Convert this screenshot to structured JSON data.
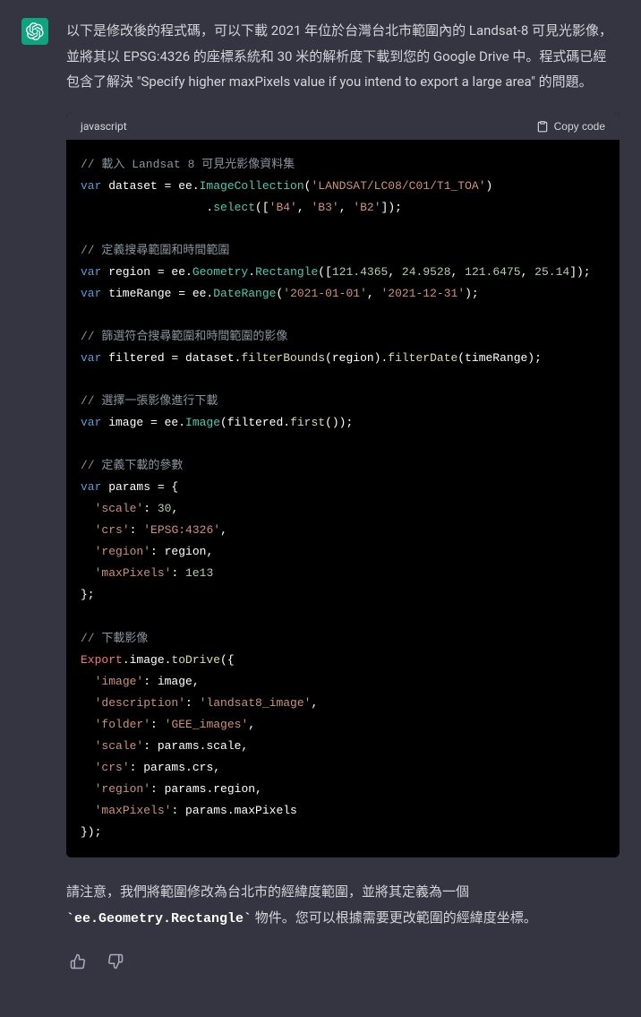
{
  "intro": "以下是修改後的程式碼，可以下載 2021 年位於台灣台北市範圍內的 Landsat-8 可見光影像，並將其以 EPSG:4326 的座標系統和 30 米的解析度下載到您的 Google Drive 中。程式碼已經包含了解決 \"Specify higher maxPixels value if you intend to export a large area\" 的問題。",
  "code_header": {
    "language": "javascript",
    "copy_label": "Copy code"
  },
  "code": {
    "c1": "// 載入 Landsat 8 可見光影像資料集",
    "kw_var": "var",
    "v_dataset": " dataset = ee.",
    "m_ic": "ImageCollection",
    "s_landsat": "'LANDSAT/LC08/C01/T1_TOA'",
    "pad_select": "                  .",
    "m_select": "select",
    "s_b4": "'B4'",
    "s_b3": "'B3'",
    "s_b2": "'B2'",
    "c2": "// 定義搜尋範圍和時間範圍",
    "v_region": " region = ee.",
    "m_geo": "Geometry",
    "m_rect": "Rectangle",
    "n1": "121.4365",
    "n2": "24.9528",
    "n3": "121.6475",
    "n4": "25.14",
    "v_timerange": " timeRange = ee.",
    "m_dr": "DateRange",
    "s_d1": "'2021-01-01'",
    "s_d2": "'2021-12-31'",
    "c3": "// 篩選符合搜尋範圍和時間範圍的影像",
    "v_filtered": " filtered = dataset.",
    "m_fb": "filterBounds",
    "t_region": "(region).",
    "m_fd": "filterDate",
    "t_timerange": "(timeRange);",
    "c4": "// 選擇一張影像進行下載",
    "v_image": " image = ee.",
    "m_img": "Image",
    "t_filtered": "(filtered.",
    "m_first": "first",
    "t_end": "());",
    "c5": "// 定義下載的參數",
    "v_params": " params = {",
    "s_scale": "'scale'",
    "n_30": "30",
    "s_crs": "'crs'",
    "s_epsg": "'EPSG:4326'",
    "s_region": "'region'",
    "t_regionval": ": region,",
    "s_maxpixels": "'maxPixels'",
    "n_1e13": "1e13",
    "t_close": "};",
    "c6": "// 下載影像",
    "r_export": "Export",
    "t_image": ".image.",
    "m_todrive": "toDrive",
    "t_open": "({",
    "s_image": "'image'",
    "t_imageval": ": image,",
    "s_desc": "'description'",
    "s_descval": "'landsat8_image'",
    "s_folder": "'folder'",
    "s_folderval": "'GEE_images'",
    "t_pscale": ": params.scale,",
    "t_pcrs": ": params.crs,",
    "t_pregion": ": params.region,",
    "t_pmaxpixels": ": params.maxPixels",
    "t_close2": "});"
  },
  "outro": {
    "p1": "請注意，我們將範圍修改為台北市的經緯度範圍，並將其定義為一個 ",
    "inline": "`ee.Geometry.Rectangle`",
    "p2": " 物件。您可以根據需要更改範圍的經緯度坐標。"
  }
}
